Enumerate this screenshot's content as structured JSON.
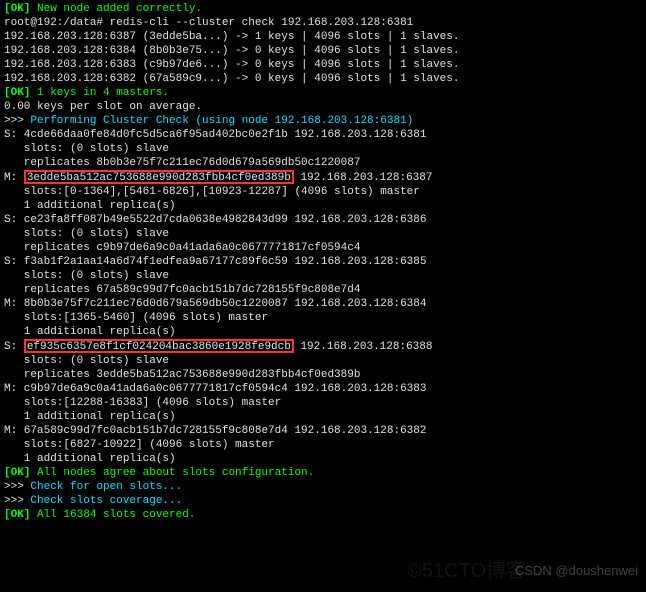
{
  "header": {
    "ok1": "[OK]",
    "msg1": " New node added correctly.",
    "prompt": "root@192:/data# redis-cli --cluster check 192.168.203.128:6381",
    "l1": "192.168.203.128:6387 (3edde5ba...) -> 1 keys | 4096 slots | 1 slaves.",
    "l2": "192.168.203.128:6384 (8b0b3e75...) -> 0 keys | 4096 slots | 1 slaves.",
    "l3": "192.168.203.128:6383 (c9b97de6...) -> 0 keys | 4096 slots | 1 slaves.",
    "l4": "192.168.203.128:6382 (67a589c9...) -> 0 keys | 4096 slots | 1 slaves.",
    "ok2": "[OK]",
    "keys": " 1 keys in 4 masters.",
    "avg": "0.00 keys per slot on average.",
    "perf_prefix": ">>> ",
    "perf": "Performing Cluster Check (using node 192.168.203.128:6381)"
  },
  "nodes": {
    "n1_a": "S: 4cde66daa0fe84d0fc5d5ca6f95ad402bc0e2f1b 192.168.203.128:6381",
    "n1_b": "   slots: (0 slots) slave",
    "n1_c": "   replicates 8b0b3e75f7c211ec76d0d679a569db50c1220087",
    "n2_pre": "M: ",
    "n2_hash": "3edde5ba512ac753688e990d283fbb4cf0ed389b",
    "n2_post": " 192.168.203.128:6387",
    "n2_b": "   slots:[0-1364],[5461-6826],[10923-12287] (4096 slots) master",
    "n2_c": "   1 additional replica(s)",
    "n3_a": "S: ce23fa8ff087b49e5522d7cda0638e4982843d99 192.168.203.128:6386",
    "n3_b": "   slots: (0 slots) slave",
    "n3_c": "   replicates c9b97de6a9c0a41ada6a0c0677771817cf0594c4",
    "n4_a": "S: f3ab1f2a1aa14a6d74f1edfea9a67177c89f6c59 192.168.203.128:6385",
    "n4_b": "   slots: (0 slots) slave",
    "n4_c": "   replicates 67a589c99d7fc0acb151b7dc728155f9c808e7d4",
    "n5_a": "M: 8b0b3e75f7c211ec76d0d679a569db50c1220087 192.168.203.128:6384",
    "n5_b": "   slots:[1365-5460] (4096 slots) master",
    "n5_c": "   1 additional replica(s)",
    "n6_pre": "S: ",
    "n6_hash": "ef935c6357e8f1cf024204bac3860e1928fe9dcb",
    "n6_post": " 192.168.203.128:6388",
    "n6_b": "   slots: (0 slots) slave",
    "n6_c": "   replicates 3edde5ba512ac753688e990d283fbb4cf0ed389b",
    "n7_a": "M: c9b97de6a9c0a41ada6a0c0677771817cf0594c4 192.168.203.128:6383",
    "n7_b": "   slots:[12288-16383] (4096 slots) master",
    "n7_c": "   1 additional replica(s)",
    "n8_a": "M: 67a589c99d7fc0acb151b7dc728155f9c808e7d4 192.168.203.128:6382",
    "n8_b": "   slots:[6827-10922] (4096 slots) master",
    "n8_c": "   1 additional replica(s)"
  },
  "footer": {
    "ok3": "[OK]",
    "agree": " All nodes agree about slots configuration.",
    "chk1_prefix": ">>> ",
    "chk1": "Check for open slots...",
    "chk2_prefix": ">>> ",
    "chk2": "Check slots coverage...",
    "ok4": "[OK]",
    "covered": " All 16384 slots covered."
  },
  "watermark": "CSDN @doushenwei",
  "watermark2": "©51CTO博客"
}
